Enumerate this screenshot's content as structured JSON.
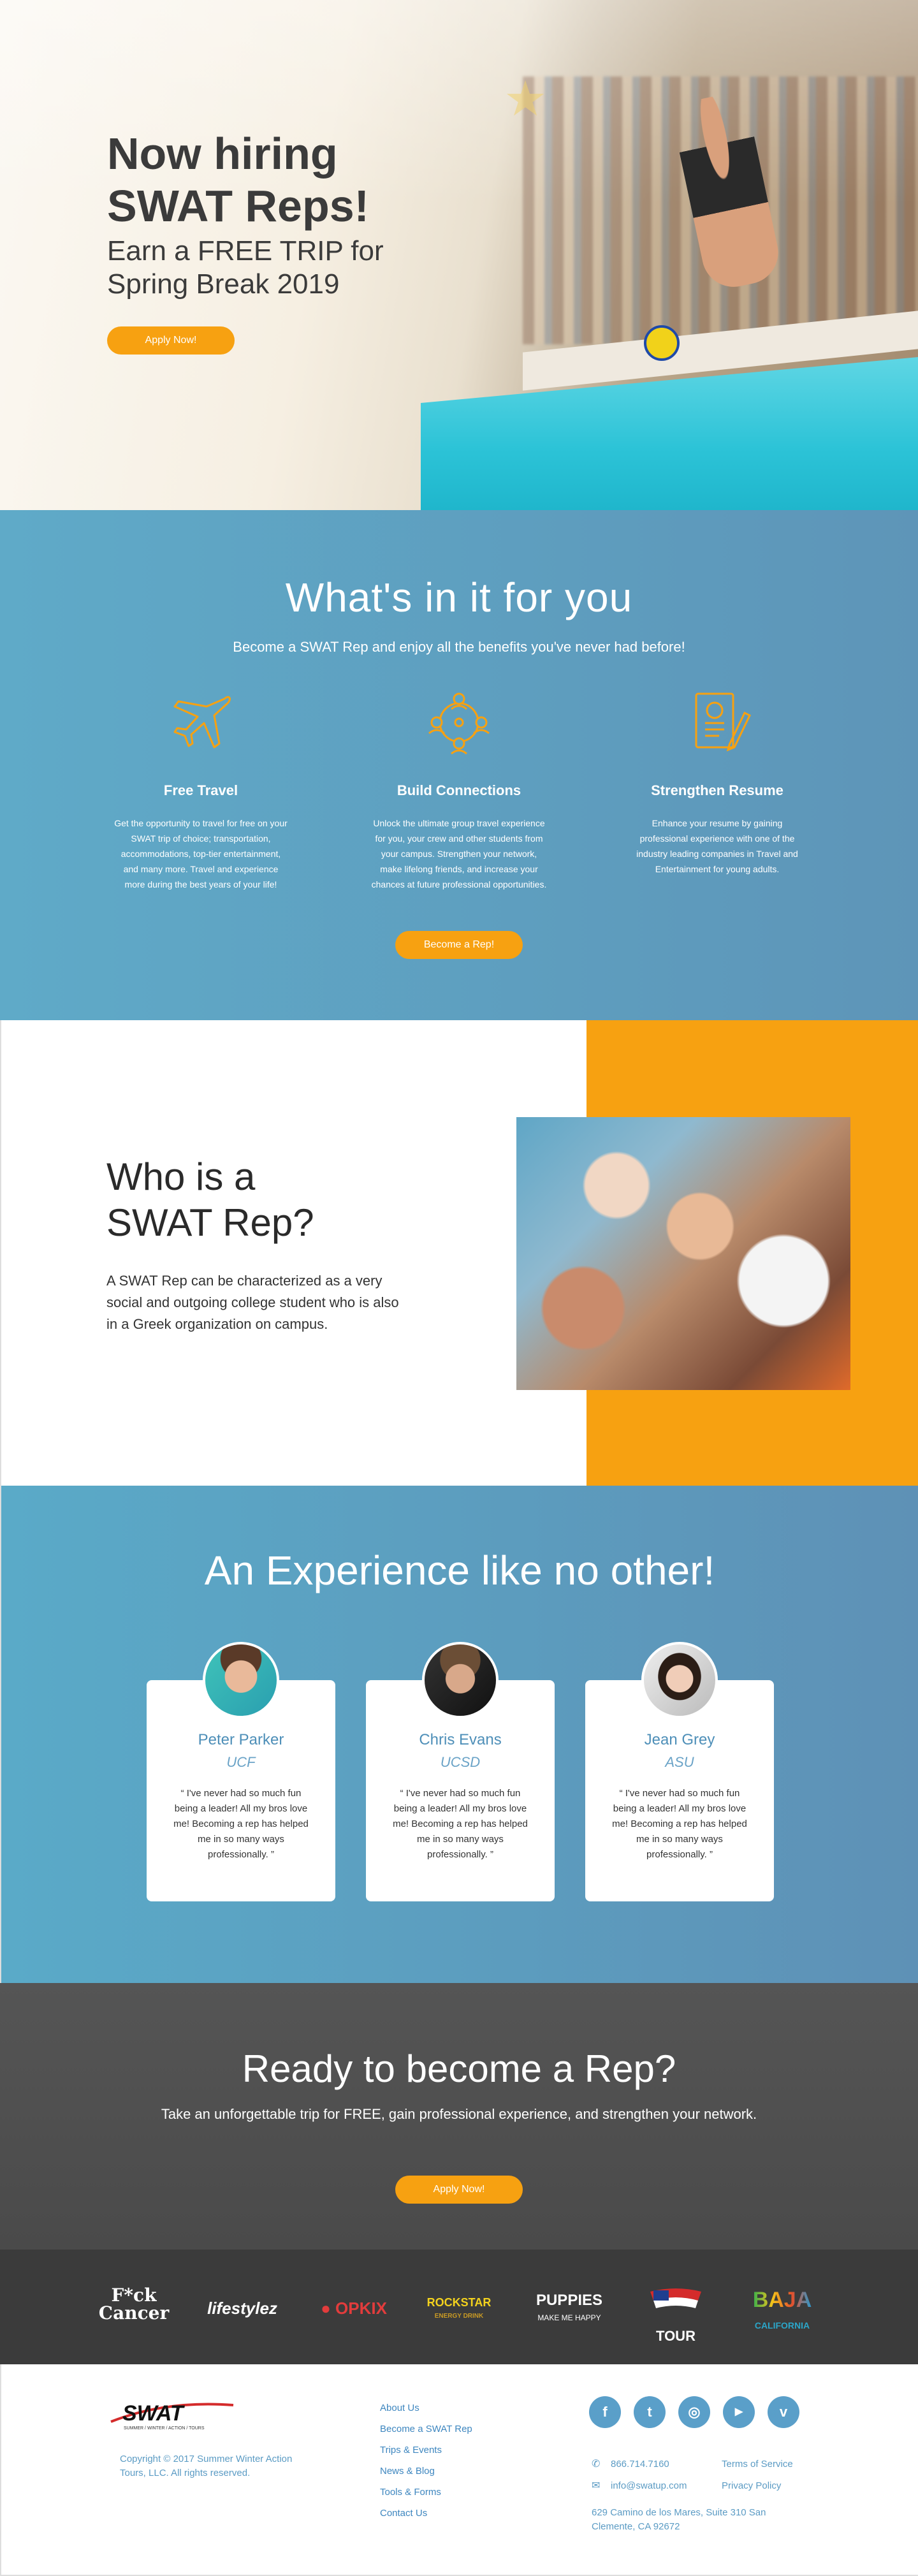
{
  "colors": {
    "accent": "#f7a111",
    "blue": "#5e9cc0",
    "dark": "#4a4a4a",
    "link": "#3d86bf"
  },
  "hero": {
    "title_line1": "Now hiring",
    "title_line2": "SWAT Reps!",
    "subtitle_line1": "Earn a FREE TRIP for",
    "subtitle_line2": "Spring Break 2019",
    "cta": "Apply Now!"
  },
  "benefits": {
    "title": "What's in it for you",
    "subtitle": "Become a SWAT Rep and enjoy all the benefits you've never had before!",
    "items": [
      {
        "icon": "airplane-icon",
        "title": "Free Travel",
        "text": "Get the opportunity to travel for free on your SWAT trip of choice; transportation, accommodations, top-tier entertainment, and many more. Travel and experience more during the best years of your life!"
      },
      {
        "icon": "network-icon",
        "title": "Build Connections",
        "text": "Unlock the ultimate group travel experience for you, your crew and other students from your campus. Strengthen your network, make lifelong friends, and increase your chances at future professional opportunities."
      },
      {
        "icon": "resume-icon",
        "title": "Strengthen Resume",
        "text": "Enhance your resume by gaining professional experience with one of the industry leading companies in Travel and Entertainment for young adults."
      }
    ],
    "cta": "Become a Rep!"
  },
  "who": {
    "title_line1": "Who is a",
    "title_line2": "SWAT Rep?",
    "text": "A SWAT Rep can be characterized as a very social and outgoing college student who is also in a Greek organization on campus."
  },
  "experience": {
    "title": "An Experience like no other!",
    "reps": [
      {
        "name": "Peter Parker",
        "school": "UCF",
        "quote": "I've never had so much fun being a leader! All my bros love me! Becoming a rep has helped me in so many ways professionally."
      },
      {
        "name": "Chris Evans",
        "school": "UCSD",
        "quote": "I've never had so much fun being a leader! All my bros love me! Becoming a rep has helped me in so many ways professionally."
      },
      {
        "name": "Jean Grey",
        "school": "ASU",
        "quote": "I've never had so much fun being a leader! All my bros love me! Becoming a rep has helped me in so many ways professionally."
      }
    ]
  },
  "ready": {
    "title": "Ready to become a Rep?",
    "subtitle": "Take an unforgettable trip for FREE, gain professional experience, and strengthen your network.",
    "cta": "Apply Now!"
  },
  "sponsors": [
    {
      "line1": "F*ck",
      "line2": "Cancer"
    },
    {
      "line1": "lifestylez",
      "line2": ""
    },
    {
      "line1": "OPKIX",
      "line2": ""
    },
    {
      "line1": "ROCKSTAR",
      "line2": "ENERGY DRINK"
    },
    {
      "line1": "PUPPIES",
      "line2": "MAKE ME HAPPY"
    },
    {
      "line1": "TOUR",
      "line2": ""
    },
    {
      "line1": "BAJA",
      "line2": "CALIFORNIA"
    }
  ],
  "footer": {
    "logo_text": "SWAT",
    "logo_tagline": "SUMMER / WINTER / ACTION / TOURS",
    "copyright": "Copyright © 2017 Summer Winter Action Tours, LLC. All rights reserved.",
    "links": [
      "About Us",
      "Become a SWAT Rep",
      "Trips & Events",
      "News & Blog",
      "Tools & Forms",
      "Contact Us"
    ],
    "social": [
      {
        "icon": "facebook-icon",
        "glyph": "f"
      },
      {
        "icon": "twitter-icon",
        "glyph": "t"
      },
      {
        "icon": "instagram-icon",
        "glyph": "◎"
      },
      {
        "icon": "youtube-icon",
        "glyph": "▶"
      },
      {
        "icon": "vimeo-icon",
        "glyph": "v"
      }
    ],
    "phone": "866.714.7160",
    "email": "info@swatup.com",
    "address": "629 Camino de los Mares, Suite 310  San Clemente, CA 92672",
    "terms": "Terms of Service",
    "privacy": "Privacy Policy"
  }
}
